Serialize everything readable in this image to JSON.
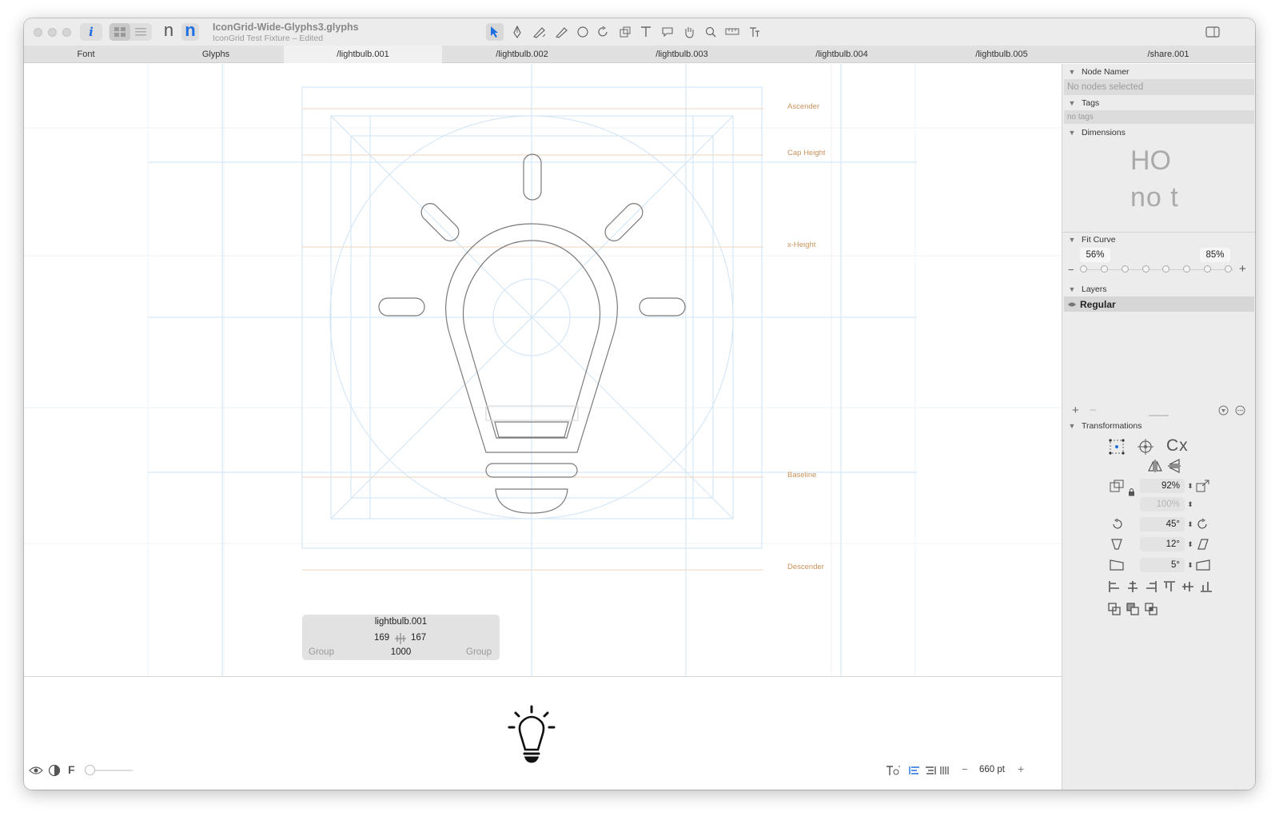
{
  "window": {
    "doc_title": "IconGrid-Wide-Glyphs3.glyphs",
    "doc_subtitle": "IconGrid Test Fixture – Edited"
  },
  "toolbar": {
    "info_label": "i",
    "glyph_n_plain": "n",
    "glyph_n_bold": "n",
    "tools": [
      "select-tool",
      "pen-tool",
      "draw-tool",
      "pencil-tool",
      "primitives-tool",
      "rotate-tool",
      "scale-tool",
      "text-tool",
      "annotation-tool",
      "hand-tool",
      "zoom-tool",
      "measure-tool",
      "type-tool"
    ]
  },
  "tabs": [
    {
      "label": "Font",
      "active": false
    },
    {
      "label": "Glyphs",
      "active": false
    },
    {
      "label": "/lightbulb.001",
      "active": true
    },
    {
      "label": "/lightbulb.002",
      "active": false
    },
    {
      "label": "/lightbulb.003",
      "active": false
    },
    {
      "label": "/lightbulb.004",
      "active": false
    },
    {
      "label": "/lightbulb.005",
      "active": false
    },
    {
      "label": "/share.001",
      "active": false
    }
  ],
  "metrics": {
    "ascender": "Ascender",
    "cap_height": "Cap Height",
    "x_height": "x-Height",
    "baseline": "Baseline",
    "descender": "Descender"
  },
  "info_box": {
    "glyph_name": "lightbulb.001",
    "lsb": "169",
    "rsb": "167",
    "width": "1000",
    "left_group": "Group",
    "right_group": "Group"
  },
  "panel": {
    "node_namer": {
      "title": "Node Namer",
      "placeholder": "No nodes selected"
    },
    "tags": {
      "title": "Tags",
      "placeholder": "no tags"
    },
    "dimensions": {
      "title": "Dimensions",
      "sample_top": "HO",
      "sample_bottom": "no t"
    },
    "fit_curve": {
      "title": "Fit Curve",
      "min": "56%",
      "max": "85%",
      "minus": "−",
      "plus": "+"
    },
    "layers": {
      "title": "Layers",
      "items": [
        "Regular"
      ]
    },
    "transformations": {
      "title": "Transformations",
      "cx_label": "Cx",
      "scale": "92%",
      "scale_y": "100%",
      "rotate": "45°",
      "slant": "12°",
      "skew": "5°"
    }
  },
  "bottom": {
    "f_label": "F",
    "size": "660 pt",
    "minus": "−",
    "plus": "+"
  },
  "colors": {
    "accent": "#1f6fe0",
    "metric_line": "#e0b48f",
    "guide": "#b9d8f2",
    "outline": "#6e6e6e"
  }
}
